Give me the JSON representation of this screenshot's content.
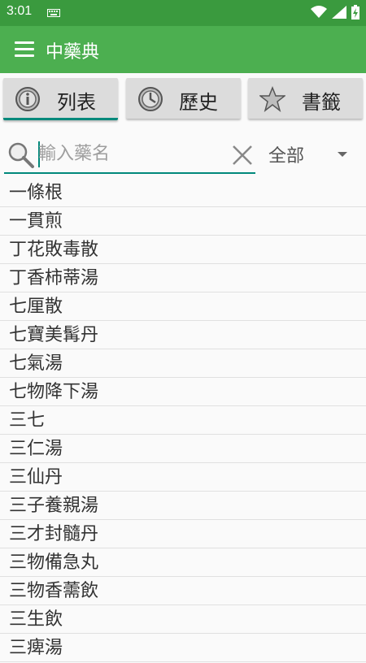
{
  "status": {
    "time": "3:01"
  },
  "app": {
    "title": "中藥典"
  },
  "tabs": [
    {
      "label": "列表",
      "active": true
    },
    {
      "label": "歷史",
      "active": false
    },
    {
      "label": "書籤",
      "active": false
    }
  ],
  "search": {
    "placeholder": "輸入藥名",
    "value": ""
  },
  "filter": {
    "selected": "全部"
  },
  "list": [
    "一條根",
    "一貫煎",
    "丁花敗毒散",
    "丁香柿蒂湯",
    "七厘散",
    "七寶美髯丹",
    "七氣湯",
    "七物降下湯",
    "三七",
    "三仁湯",
    "三仙丹",
    "三子養親湯",
    "三才封髓丹",
    "三物備急丸",
    "三物香薷飲",
    "三生飲",
    "三痺湯"
  ],
  "colors": {
    "statusbar": "#3a9a3e",
    "appbar": "#4caf50",
    "accent": "#00897b"
  }
}
